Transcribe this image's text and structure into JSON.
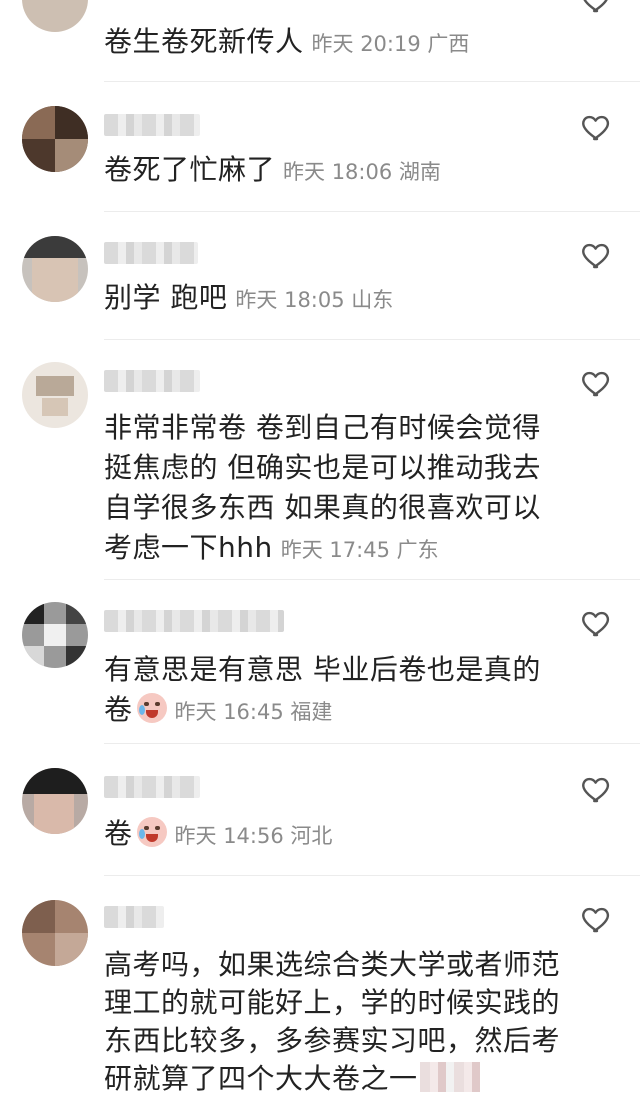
{
  "comments": [
    {
      "text": "卷生卷死新传人",
      "time": "昨天 20:19",
      "location": "广西"
    },
    {
      "text": "卷死了忙麻了",
      "time": "昨天 18:06",
      "location": "湖南"
    },
    {
      "text": "别学 跑吧",
      "time": "昨天 18:05",
      "location": "山东"
    },
    {
      "text": "非常非常卷 卷到自己有时候会觉得挺焦虑的 但确实也是可以推动我去自学很多东西 如果真的很喜欢可以考虑一下hhh",
      "time": "昨天 17:45",
      "location": "广东"
    },
    {
      "text": "有意思是有意思 毕业后卷也是真的卷",
      "time": "昨天 16:45",
      "location": "福建"
    },
    {
      "text": "卷",
      "time": "昨天 14:56",
      "location": "河北"
    },
    {
      "text": "高考吗，如果选综合类大学或者师范理工的就可能好上，学的时候实践的东西比较多，多参赛实习吧，然后考研就算了四个大大卷之一",
      "time": "",
      "location": ""
    }
  ],
  "icons": {
    "like": "heart-outline-icon",
    "emoji": "crying-face-emoji"
  },
  "colors": {
    "text": "#222222",
    "meta": "#8a8a8a",
    "icon": "#555555"
  }
}
